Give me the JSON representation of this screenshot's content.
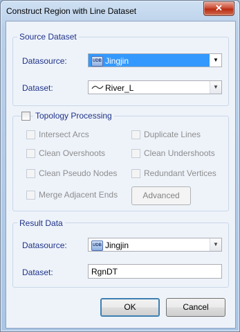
{
  "window": {
    "title": "Construct Region with Line Dataset",
    "close_glyph": "✕"
  },
  "source": {
    "group_title": "Source Dataset",
    "datasource_label": "Datasource:",
    "datasource_value": "Jingjin",
    "dataset_label": "Dataset:",
    "dataset_value": "River_L"
  },
  "topology": {
    "group_title": "Topology Processing",
    "checked": false,
    "options": [
      {
        "label": "Intersect Arcs",
        "checked": false
      },
      {
        "label": "Duplicate Lines",
        "checked": false
      },
      {
        "label": "Clean Overshoots",
        "checked": false
      },
      {
        "label": "Clean Undershoots",
        "checked": false
      },
      {
        "label": "Clean Pseudo Nodes",
        "checked": false
      },
      {
        "label": "Redundant Vertices",
        "checked": false
      },
      {
        "label": "Merge Adjacent Ends",
        "checked": false
      }
    ],
    "advanced_label": "Advanced"
  },
  "result": {
    "group_title": "Result Data",
    "datasource_label": "Datasource:",
    "datasource_value": "Jingjin",
    "dataset_label": "Dataset:",
    "dataset_value": "RgnDT"
  },
  "buttons": {
    "ok": "OK",
    "cancel": "Cancel"
  },
  "icons": {
    "udb": "UDB",
    "dropdown": "▼"
  }
}
